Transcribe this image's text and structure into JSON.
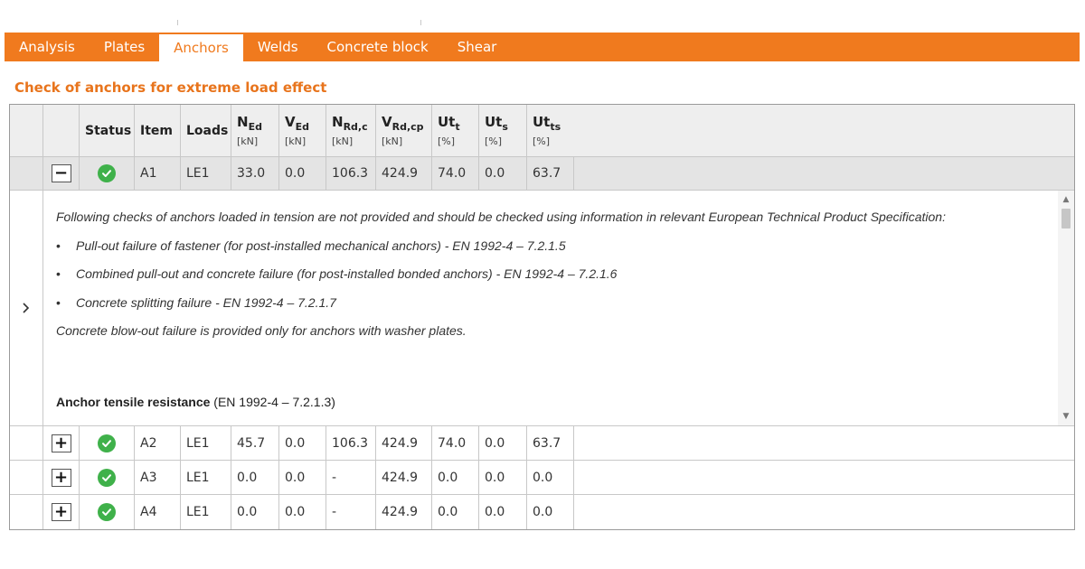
{
  "tabs": [
    {
      "label": "Analysis"
    },
    {
      "label": "Plates"
    },
    {
      "label": "Anchors",
      "active": true
    },
    {
      "label": "Welds"
    },
    {
      "label": "Concrete block"
    },
    {
      "label": "Shear"
    }
  ],
  "section_title": "Check of anchors for extreme load effect",
  "colors": {
    "accent": "#f07a1e",
    "ok": "#3fb14a"
  },
  "columns": {
    "status": "Status",
    "item": "Item",
    "loads": "Loads",
    "ned": {
      "sym": "N",
      "sub": "Ed",
      "unit": "[kN]"
    },
    "ved": {
      "sym": "V",
      "sub": "Ed",
      "unit": "[kN]"
    },
    "nrdc": {
      "sym": "N",
      "sub": "Rd,c",
      "unit": "[kN]"
    },
    "vrdcp": {
      "sym": "V",
      "sub": "Rd,cp",
      "unit": "[kN]"
    },
    "utt": {
      "sym": "Ut",
      "sub": "t",
      "unit": "[%]"
    },
    "uts": {
      "sym": "Ut",
      "sub": "s",
      "unit": "[%]"
    },
    "utts": {
      "sym": "Ut",
      "sub": "ts",
      "unit": "[%]"
    }
  },
  "rows": [
    {
      "toggle": "−",
      "item": "A1",
      "loads": "LE1",
      "ned": "33.0",
      "ved": "0.0",
      "nrdc": "106.3",
      "vrdcp": "424.9",
      "utt": "74.0",
      "uts": "0.0",
      "utts": "63.7"
    },
    {
      "toggle": "+",
      "item": "A2",
      "loads": "LE1",
      "ned": "45.7",
      "ved": "0.0",
      "nrdc": "106.3",
      "vrdcp": "424.9",
      "utt": "74.0",
      "uts": "0.0",
      "utts": "63.7"
    },
    {
      "toggle": "+",
      "item": "A3",
      "loads": "LE1",
      "ned": "0.0",
      "ved": "0.0",
      "nrdc": "-",
      "vrdcp": "424.9",
      "utt": "0.0",
      "uts": "0.0",
      "utts": "0.0"
    },
    {
      "toggle": "+",
      "item": "A4",
      "loads": "LE1",
      "ned": "0.0",
      "ved": "0.0",
      "nrdc": "-",
      "vrdcp": "424.9",
      "utt": "0.0",
      "uts": "0.0",
      "utts": "0.0"
    }
  ],
  "details": {
    "intro": "Following checks of anchors loaded in tension are not provided and should be checked using information in relevant European Technical Product Specification:",
    "bullets": [
      "Pull-out failure of fastener (for post-installed mechanical anchors) - EN 1992-4 – 7.2.1.5",
      "Combined pull-out and concrete failure (for post-installed bonded anchors) - EN 1992-4 – 7.2.1.6",
      "Concrete splitting failure - EN 1992-4 – 7.2.1.7"
    ],
    "note": "Concrete blow-out failure is provided only for anchors with washer plates.",
    "subhead_bold": "Anchor tensile resistance",
    "subhead_ref": " (EN 1992-4 – 7.2.1.3)"
  }
}
